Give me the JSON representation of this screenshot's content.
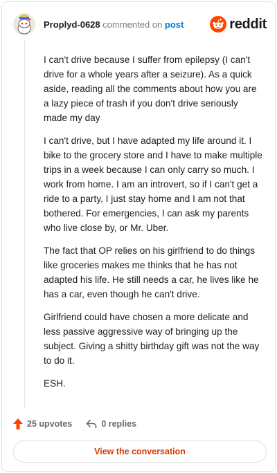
{
  "header": {
    "username": "Proplyd-0628",
    "action_text": "commented on",
    "target_text": "post",
    "brand_text": "reddit"
  },
  "comment": {
    "paragraphs": [
      "I can't drive because I suffer from epilepsy (I can't drive for a whole years after a seizure). As a quick aside, reading all the comments about how you are a lazy piece of trash if you don't drive seriously made my day",
      "I can't drive, but I have adapted my life around it. I bike to the grocery store and I have to make multiple trips in a week because I can only carry so much. I work from home. I am an introvert, so if I can't get a ride to a party, I just stay home and I am not that bothered. For emergencies, I can ask my parents who live close by, or Mr. Uber.",
      "The fact that OP relies on his girlfriend to do things like groceries makes me thinks that he has not adapted his life. He still needs a car, he lives like he has a car, even though he can't drive.",
      "Girlfriend could have chosen a more delicate and less passive aggressive way of bringing up the subject. Giving a shitty birthday gift was not the way to do it.",
      "ESH."
    ]
  },
  "footer": {
    "upvotes_label": "25 upvotes",
    "replies_label": "0 replies",
    "view_button_label": "View the conversation"
  },
  "colors": {
    "accent_orange": "#ff4500",
    "link_blue": "#0079d3",
    "button_text": "#d93a00"
  }
}
